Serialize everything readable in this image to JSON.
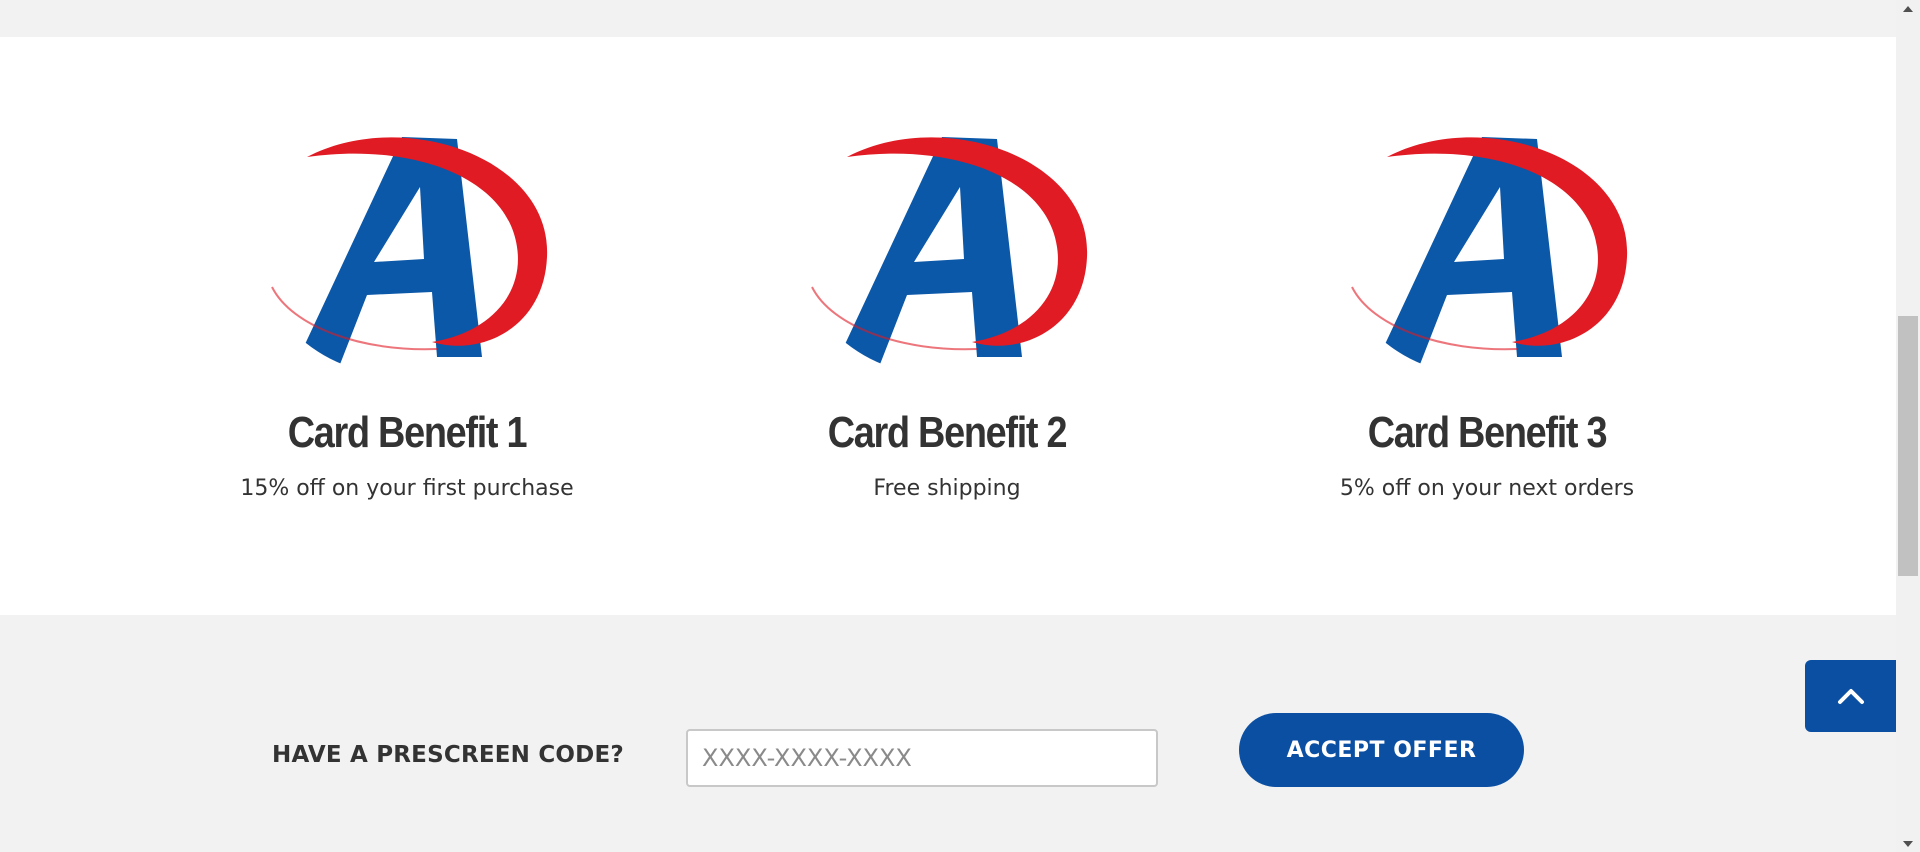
{
  "benefits": [
    {
      "title": "Card Benefit 1",
      "description": "15% off on your first purchase",
      "icon": "brand-logo-icon"
    },
    {
      "title": "Card Benefit 2",
      "description": "Free shipping",
      "icon": "brand-logo-icon"
    },
    {
      "title": "Card Benefit 3",
      "description": "5% off on your next orders",
      "icon": "brand-logo-icon"
    }
  ],
  "prescreen": {
    "label": "HAVE A PRESCREEN CODE?",
    "placeholder": "XXXX-XXXX-XXXX",
    "value": ""
  },
  "accept_button": {
    "label": "ACCEPT OFFER"
  },
  "back_to_top": {
    "icon": "chevron-up-icon"
  },
  "colors": {
    "brand_blue": "#0b4fa3",
    "brand_red": "#e01b24",
    "text": "#333333",
    "section_bg": "#f2f2f2"
  }
}
